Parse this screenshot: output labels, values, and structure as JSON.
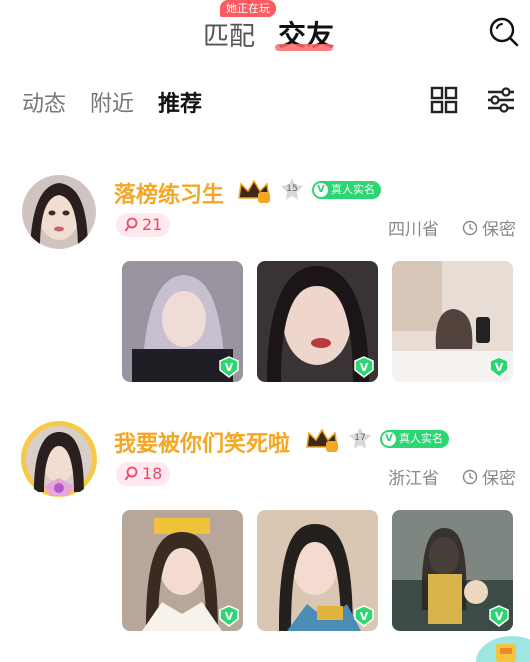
{
  "header": {
    "tab_match": "匹配",
    "tab_friend": "交友",
    "playing_badge": "她正在玩",
    "search_icon": "search-icon"
  },
  "subtabs": {
    "items": [
      "动态",
      "附近",
      "推荐"
    ],
    "active": "推荐",
    "grid_icon": "grid-view-icon",
    "filter_icon": "filter-sliders-icon"
  },
  "colors": {
    "nickname": "#f5a623",
    "verified": "#2ed573",
    "likes_text": "#e84a6b",
    "likes_bg": "#ffe9ee",
    "tab_underline": "#ff6b6b",
    "badge": "#ff5a5f"
  },
  "feed": [
    {
      "nickname": "落榜练习生",
      "level": "15",
      "verified_label": "真人实名",
      "likes": "21",
      "location": "四川省",
      "privacy": "保密",
      "photos": [
        "photo-1",
        "photo-2",
        "photo-3"
      ]
    },
    {
      "nickname": "我要被你们笑死啦",
      "level": "17",
      "verified_label": "真人实名",
      "likes": "18",
      "location": "浙江省",
      "privacy": "保密",
      "photos": [
        "photo-1",
        "photo-2",
        "photo-3"
      ]
    }
  ]
}
